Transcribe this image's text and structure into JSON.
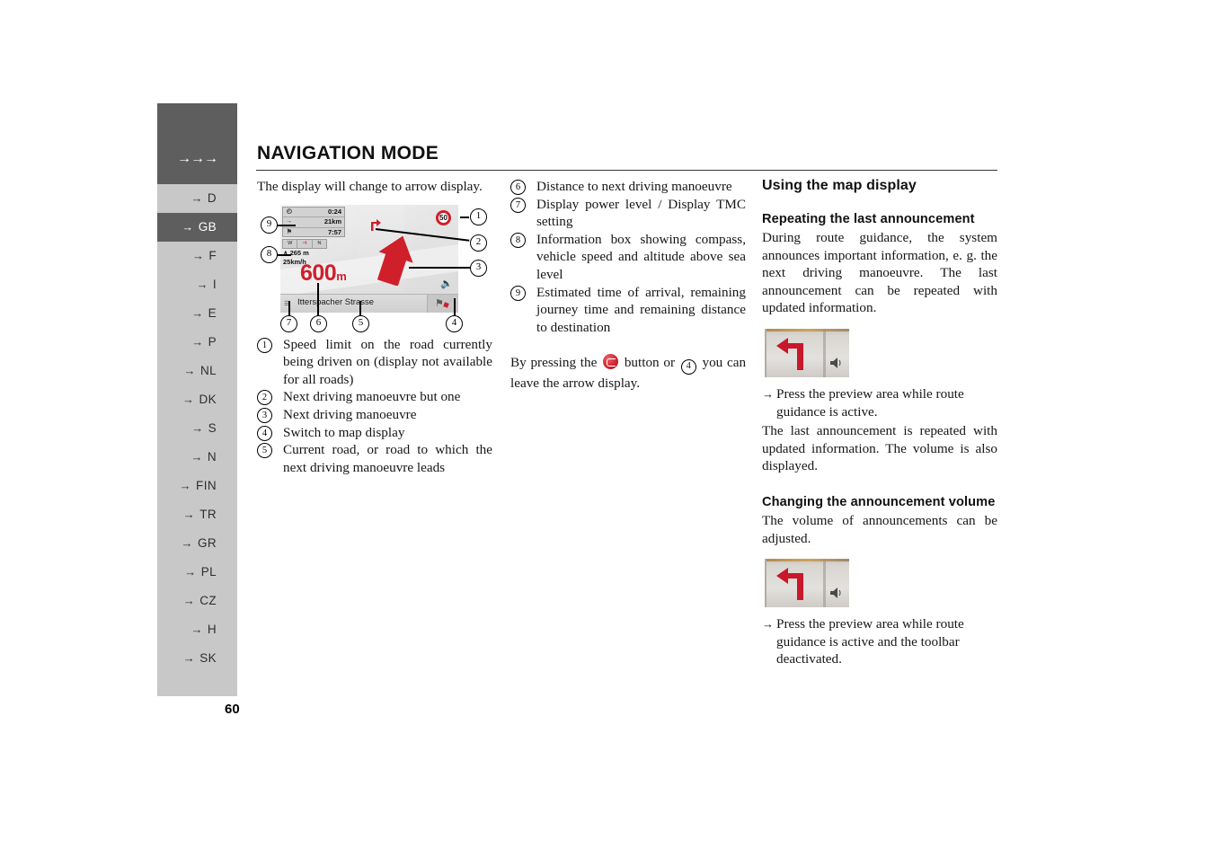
{
  "document": {
    "page_number": "60",
    "title": "NAVIGATION MODE",
    "header_arrows": "→→→"
  },
  "sidebar": {
    "items": [
      {
        "label": "D",
        "arrow": "→",
        "selected": false
      },
      {
        "label": "GB",
        "arrow": "→",
        "selected": true
      },
      {
        "label": "F",
        "arrow": "→",
        "selected": false
      },
      {
        "label": "I",
        "arrow": "→",
        "selected": false
      },
      {
        "label": "E",
        "arrow": "→",
        "selected": false
      },
      {
        "label": "P",
        "arrow": "→",
        "selected": false
      },
      {
        "label": "NL",
        "arrow": "→",
        "selected": false
      },
      {
        "label": "DK",
        "arrow": "→",
        "selected": false
      },
      {
        "label": "S",
        "arrow": "→",
        "selected": false
      },
      {
        "label": "N",
        "arrow": "→",
        "selected": false
      },
      {
        "label": "FIN",
        "arrow": "→",
        "selected": false
      },
      {
        "label": "TR",
        "arrow": "→",
        "selected": false
      },
      {
        "label": "GR",
        "arrow": "→",
        "selected": false
      },
      {
        "label": "PL",
        "arrow": "→",
        "selected": false
      },
      {
        "label": "CZ",
        "arrow": "→",
        "selected": false
      },
      {
        "label": "H",
        "arrow": "→",
        "selected": false
      },
      {
        "label": "SK",
        "arrow": "→",
        "selected": false
      }
    ],
    "colors": {
      "background": "#c8c8c8",
      "selected_background": "#5e5e5e",
      "header_block": "#5e5e5e"
    }
  },
  "column_left": {
    "intro": "The display will change to arrow display.",
    "items": [
      {
        "num": "1",
        "text": "Speed limit on the road currently being driven on (display not available for all roads)"
      },
      {
        "num": "2",
        "text": "Next driving manoeuvre but one"
      },
      {
        "num": "3",
        "text": "Next driving manoeuvre"
      },
      {
        "num": "4",
        "text": "Switch to map display"
      },
      {
        "num": "5",
        "text": "Current road, or road to which the next driving manoeuvre leads"
      }
    ]
  },
  "column_mid": {
    "items": [
      {
        "num": "6",
        "text": "Distance to next driving manoeuvre"
      },
      {
        "num": "7",
        "text": "Display power level / Display TMC setting"
      },
      {
        "num": "8",
        "text": "Information box showing compass, vehicle speed and altitude above sea level"
      },
      {
        "num": "9",
        "text": "Estimated time of arrival, remaining journey time and remaining distance to destination"
      }
    ],
    "closing": {
      "part1": "By pressing the",
      "part2": "button or",
      "part3": "you can leave the arrow display.",
      "inline_button_icon": "nav-mode-button-icon",
      "inline_number": "4"
    }
  },
  "column_right": {
    "section_title": "Using the map display",
    "blocks": [
      {
        "heading": "Repeating the last announcement",
        "paragraph": "During route guidance, the system announces important information, e. g. the next driving manoeuvre. The last announcement can be repeated with updated information.",
        "image_caption": "preview-area-left-turn-with-speaker",
        "bullet_arrow": "→",
        "bullet": "Press the preview area while route guidance is active.",
        "after": "The last announcement is repeated with updated information. The volume is also displayed."
      },
      {
        "heading": "Changing the announcement volume",
        "paragraph": "The volume of announcements can be adjusted.",
        "image_caption": "preview-area-left-turn-with-speaker",
        "bullet_arrow": "→",
        "bullet": "Press the preview area while route guidance is active and the toolbar deactivated.",
        "after": ""
      }
    ]
  },
  "nav_figure": {
    "eta_rows": [
      {
        "icon": "clock-icon",
        "icon_glyph": "◔",
        "value": "0:24"
      },
      {
        "icon": "distance-icon",
        "icon_glyph": "→",
        "value": "21km"
      },
      {
        "icon": "destination-flag-icon",
        "icon_glyph": "⚑",
        "value": "7:57"
      }
    ],
    "compass_segments": [
      "W",
      "⊣",
      "N"
    ],
    "altitude": "∧ 265 m",
    "speed": "25km/h",
    "distance_value": "600",
    "distance_unit": "m",
    "street_name": "Itterspacher Strasse",
    "speed_limit": "50",
    "tmc_icon": "signal-bars-icon",
    "map_button_icon": "map-display-icon",
    "speaker_icon": "speaker-icon",
    "manoeuvre_arrow_color": "#cf1f2b",
    "callouts": [
      "1",
      "2",
      "3",
      "4",
      "5",
      "6",
      "7",
      "8",
      "9"
    ]
  }
}
